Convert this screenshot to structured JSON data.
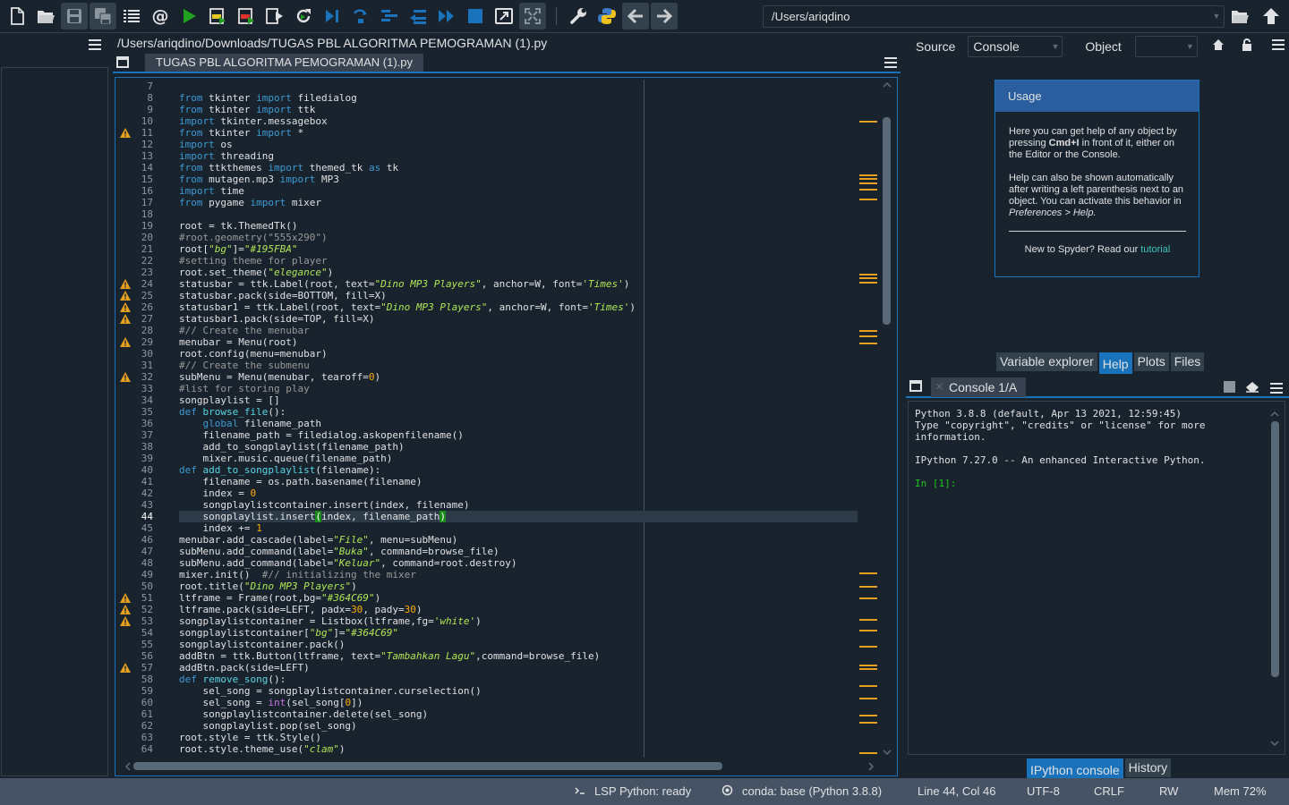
{
  "toolbar": {
    "path": "/Users/ariqdino",
    "icons": [
      "new-file-icon",
      "open-file-icon",
      "save-icon",
      "save-all-icon",
      "outline-list-icon",
      "at-icon",
      "run-icon",
      "run-cell-icon",
      "run-cell-advance-icon",
      "run-selection-icon",
      "rerun-icon",
      "debug-icon",
      "step-icon",
      "step-into-icon",
      "step-return-icon",
      "continue-icon",
      "stop-icon",
      "maximize-pane-icon",
      "fullscreen-icon",
      "wrench-icon",
      "python-path-icon",
      "back-arrow-icon",
      "forward-arrow-icon",
      "browse-folder-icon",
      "parent-dir-icon"
    ]
  },
  "editor": {
    "file_path": "/Users/ariqdino/Downloads/TUGAS PBL ALGORITMA PEMOGRAMAN (1).py",
    "tab_label": "TUGAS PBL ALGORITMA PEMOGRAMAN (1).py",
    "current_line": "44",
    "warning_lines": [
      "11",
      "24",
      "25",
      "26",
      "27",
      "29",
      "32",
      "51",
      "52",
      "53",
      "57"
    ],
    "lines": [
      {
        "n": "7",
        "t": ""
      },
      {
        "n": "8",
        "t": "from tkinter import filedialog"
      },
      {
        "n": "9",
        "t": "from tkinter import ttk"
      },
      {
        "n": "10",
        "t": "import tkinter.messagebox"
      },
      {
        "n": "11",
        "t": "from tkinter import *"
      },
      {
        "n": "12",
        "t": "import os"
      },
      {
        "n": "13",
        "t": "import threading"
      },
      {
        "n": "14",
        "t": "from ttkthemes import themed_tk as tk"
      },
      {
        "n": "15",
        "t": "from mutagen.mp3 import MP3"
      },
      {
        "n": "16",
        "t": "import time"
      },
      {
        "n": "17",
        "t": "from pygame import mixer"
      },
      {
        "n": "18",
        "t": ""
      },
      {
        "n": "19",
        "t": "root = tk.ThemedTk()"
      },
      {
        "n": "20",
        "t": "#root.geometry(\"555x290\")"
      },
      {
        "n": "21",
        "t": "root[\"bg\"]=\"#195FBA\""
      },
      {
        "n": "22",
        "t": "#setting theme for player"
      },
      {
        "n": "23",
        "t": "root.set_theme(\"elegance\")"
      },
      {
        "n": "24",
        "t": "statusbar = ttk.Label(root, text=\"Dino MP3 Players\", anchor=W, font='Times')"
      },
      {
        "n": "25",
        "t": "statusbar.pack(side=BOTTOM, fill=X)"
      },
      {
        "n": "26",
        "t": "statusbar1 = ttk.Label(root, text=\"Dino MP3 Players\", anchor=W, font='Times')"
      },
      {
        "n": "27",
        "t": "statusbar1.pack(side=TOP, fill=X)"
      },
      {
        "n": "28",
        "t": "#// Create the menubar"
      },
      {
        "n": "29",
        "t": "menubar = Menu(root)"
      },
      {
        "n": "30",
        "t": "root.config(menu=menubar)"
      },
      {
        "n": "31",
        "t": "#// Create the submenu"
      },
      {
        "n": "32",
        "t": "subMenu = Menu(menubar, tearoff=0)"
      },
      {
        "n": "33",
        "t": "#list for storing play"
      },
      {
        "n": "34",
        "t": "songplaylist = []"
      },
      {
        "n": "35",
        "t": "def browse_file():"
      },
      {
        "n": "36",
        "t": "    global filename_path"
      },
      {
        "n": "37",
        "t": "    filename_path = filedialog.askopenfilename()"
      },
      {
        "n": "38",
        "t": "    add_to_songplaylist(filename_path)"
      },
      {
        "n": "39",
        "t": "    mixer.music.queue(filename_path)"
      },
      {
        "n": "40",
        "t": "def add_to_songplaylist(filename):"
      },
      {
        "n": "41",
        "t": "    filename = os.path.basename(filename)"
      },
      {
        "n": "42",
        "t": "    index = 0"
      },
      {
        "n": "43",
        "t": "    songplaylistcontainer.insert(index, filename)"
      },
      {
        "n": "44",
        "t": "    songplaylist.insert(index, filename_path)"
      },
      {
        "n": "45",
        "t": "    index += 1"
      },
      {
        "n": "46",
        "t": "menubar.add_cascade(label=\"File\", menu=subMenu)"
      },
      {
        "n": "47",
        "t": "subMenu.add_command(label=\"Buka\", command=browse_file)"
      },
      {
        "n": "48",
        "t": "subMenu.add_command(label=\"Keluar\", command=root.destroy)"
      },
      {
        "n": "49",
        "t": "mixer.init()  #// initializing the mixer"
      },
      {
        "n": "50",
        "t": "root.title(\"Dino MP3 Players\")"
      },
      {
        "n": "51",
        "t": "ltframe = Frame(root,bg=\"#364C69\")"
      },
      {
        "n": "52",
        "t": "ltframe.pack(side=LEFT, padx=30, pady=30)"
      },
      {
        "n": "53",
        "t": "songplaylistcontainer = Listbox(ltframe,fg='white')"
      },
      {
        "n": "54",
        "t": "songplaylistcontainer[\"bg\"]=\"#364C69\""
      },
      {
        "n": "55",
        "t": "songplaylistcontainer.pack()"
      },
      {
        "n": "56",
        "t": "addBtn = ttk.Button(ltframe, text=\"Tambahkan Lagu\",command=browse_file)"
      },
      {
        "n": "57",
        "t": "addBtn.pack(side=LEFT)"
      },
      {
        "n": "58",
        "t": "def remove_song():"
      },
      {
        "n": "59",
        "t": "    sel_song = songplaylistcontainer.curselection()"
      },
      {
        "n": "60",
        "t": "    sel_song = int(sel_song[0])"
      },
      {
        "n": "61",
        "t": "    songplaylistcontainer.delete(sel_song)"
      },
      {
        "n": "62",
        "t": "    songplaylist.pop(sel_song)"
      },
      {
        "n": "63",
        "t": "root.style = ttk.Style()"
      },
      {
        "n": "64",
        "t": "root.style.theme_use(\"clam\")"
      }
    ]
  },
  "help": {
    "source_label": "Source",
    "source_value": "Console",
    "object_label": "Object",
    "object_value": "",
    "usage_title": "Usage",
    "usage_p1_a": "Here you can get help of any object by pressing ",
    "usage_p1_key": "Cmd+I",
    "usage_p1_b": " in front of it, either on the Editor or the Console.",
    "usage_p2_a": "Help can also be shown automatically after writing a left parenthesis next to an object. You can activate this behavior in ",
    "usage_p2_em": "Preferences > Help.",
    "usage_foot": "New to Spyder? Read our ",
    "usage_link": "tutorial",
    "tabs": [
      "Variable explorer",
      "Help",
      "Plots",
      "Files"
    ],
    "selected_tab": "Help"
  },
  "console": {
    "tab_label": "Console 1/A",
    "banner_1": "Python 3.8.8 (default, Apr 13 2021, 12:59:45)",
    "banner_2": "Type \"copyright\", \"credits\" or \"license\" for more",
    "banner_3": "information.",
    "banner_4": "IPython 7.27.0 -- An enhanced Interactive Python.",
    "prompt": "In [1]:",
    "bottom_tabs": [
      "IPython console",
      "History"
    ],
    "selected_tab": "IPython console"
  },
  "statusbar": {
    "lsp": "LSP Python: ready",
    "conda": "conda: base (Python 3.8.8)",
    "position": "Line 44, Col 46",
    "encoding": "UTF-8",
    "eol": "CRLF",
    "mode": "RW",
    "memory": "Mem 72%"
  },
  "colors": {
    "background": "#19232d",
    "accent": "#1a72bb",
    "keyword": "#3c9ad6",
    "string": "#b0e655",
    "number": "#ffaa00",
    "warning": "#e6a020"
  }
}
